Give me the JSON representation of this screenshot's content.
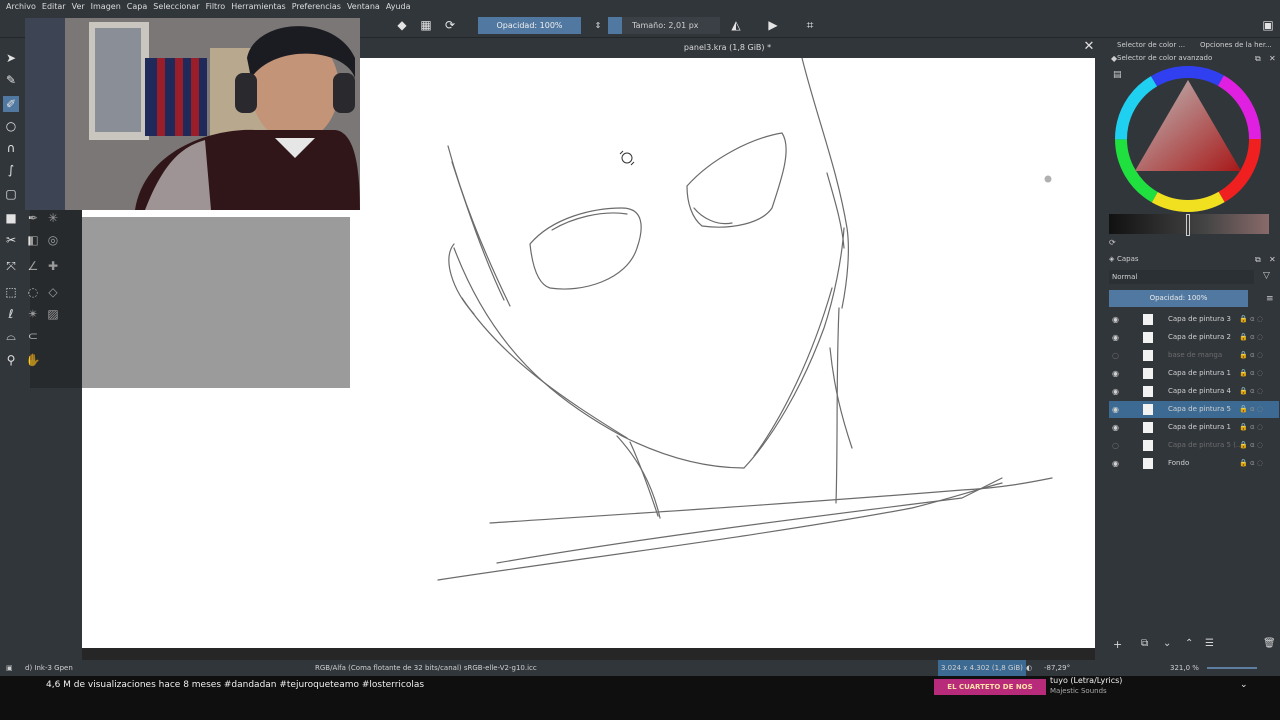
{
  "menu": [
    "Archivo",
    "Editar",
    "Ver",
    "Imagen",
    "Capa",
    "Seleccionar",
    "Filtro",
    "Herramientas",
    "Preferencias",
    "Ventana",
    "Ayuda"
  ],
  "toolbar": {
    "opacity_label": "Opacidad: 100%",
    "size_label": "Tamaño: 2,01 px"
  },
  "document": {
    "tab_title": "panel3.kra (1,8 GiB) *"
  },
  "docker": {
    "tab1": "Selector de color ...",
    "tab2": "Opciones de la her...",
    "color_selector_title": "Selector de color avanzado",
    "layers_title": "Capas",
    "blend_mode": "Normal",
    "layer_opacity": "Opacidad: 100%",
    "layers": [
      {
        "name": "Capa de pintura 3",
        "visible": true,
        "selected": false
      },
      {
        "name": "Capa de pintura 2",
        "visible": true,
        "selected": false
      },
      {
        "name": "base de manga",
        "visible": false,
        "selected": false
      },
      {
        "name": "Capa de pintura 1",
        "visible": true,
        "selected": false
      },
      {
        "name": "Capa de pintura 4",
        "visible": true,
        "selected": false
      },
      {
        "name": "Capa de pintura 5",
        "visible": true,
        "selected": true
      },
      {
        "name": "Capa de pintura 1",
        "visible": true,
        "selected": false
      },
      {
        "name": "Capa de pintura 5 (...",
        "visible": false,
        "selected": false
      },
      {
        "name": "Fondo",
        "visible": true,
        "selected": false
      }
    ]
  },
  "status": {
    "brush": "d) Ink-3 Gpen",
    "color_space": "RGB/Alfa (Coma flotante de 32 bits/canal)  sRGB-elle-V2-g10.icc",
    "image_size": "3.024 x 4.302 (1,8 GiB)",
    "rotation": "-87,29°",
    "zoom": "321,0 %"
  },
  "youtube": {
    "meta": "4,6 M de visualizaciones  hace 8 meses  #dandadan #tejuroqueteamo #losterricolas",
    "ad_text": "EL CUARTETO DE NOS",
    "song_title": "tuyo (Letra/Lyrics)",
    "channel": "Majestic Sounds"
  }
}
